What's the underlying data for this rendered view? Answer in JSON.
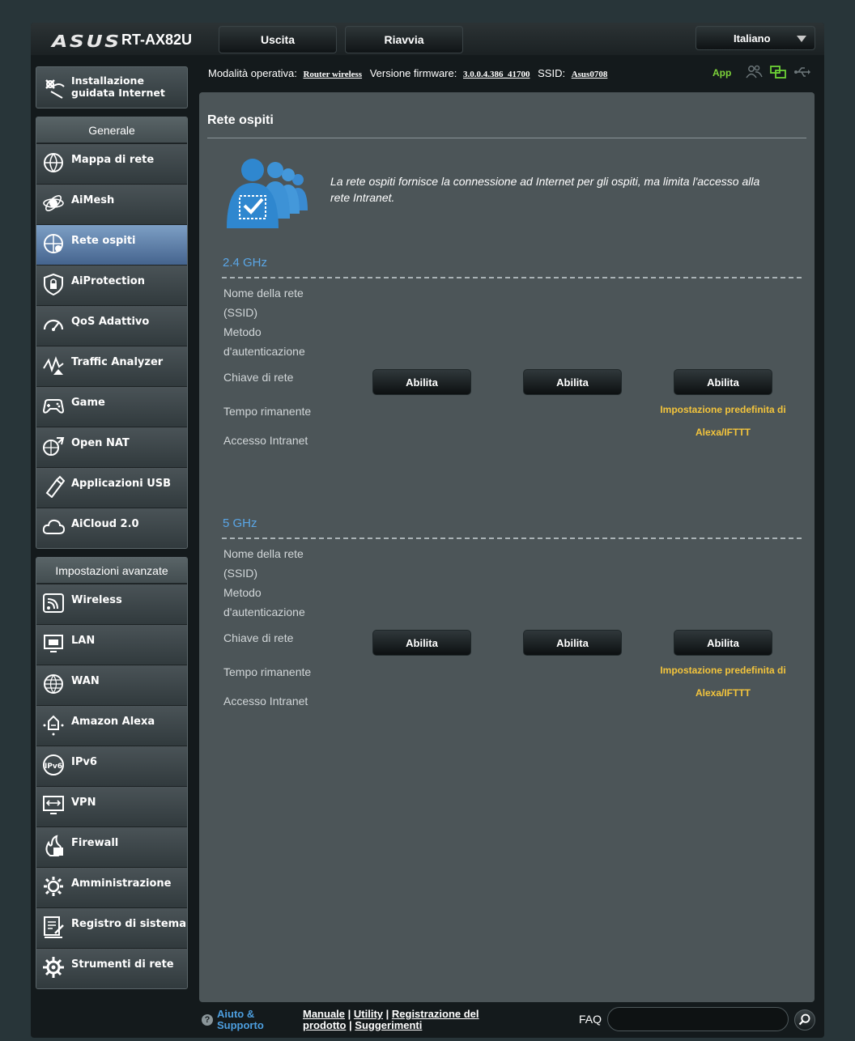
{
  "header": {
    "brand": "ASUS",
    "model": "RT-AX82U",
    "logout_label": "Uscita",
    "reboot_label": "Riavvia",
    "language": "Italiano"
  },
  "status": {
    "mode_label": "Modalità operativa:",
    "mode_value": "Router wireless",
    "firmware_label": "Versione firmware:",
    "firmware_value": "3.0.0.4.386_41700",
    "ssid_label": "SSID:",
    "ssid_value": "Asus0708",
    "app_label": "App",
    "icons": [
      "clients-icon",
      "network-map-icon",
      "usb-icon"
    ]
  },
  "sidebar": {
    "quick_setup": "Installazione guidata Internet",
    "general_title": "Generale",
    "general_items": [
      {
        "label": "Mappa di rete",
        "icon": "network-map-icon"
      },
      {
        "label": "AiMesh",
        "icon": "aimesh-icon"
      },
      {
        "label": "Rete ospiti",
        "icon": "guest-network-icon",
        "active": true
      },
      {
        "label": "AiProtection",
        "icon": "shield-icon"
      },
      {
        "label": "QoS Adattivo",
        "icon": "qos-gauge-icon"
      },
      {
        "label": "Traffic Analyzer",
        "icon": "traffic-analyzer-icon"
      },
      {
        "label": "Game",
        "icon": "gamepad-icon"
      },
      {
        "label": "Open NAT",
        "icon": "open-nat-icon"
      },
      {
        "label": "Applicazioni USB",
        "icon": "usb-app-icon"
      },
      {
        "label": "AiCloud 2.0",
        "icon": "cloud-icon"
      }
    ],
    "advanced_title": "Impostazioni avanzate",
    "advanced_items": [
      {
        "label": "Wireless",
        "icon": "wireless-icon"
      },
      {
        "label": "LAN",
        "icon": "lan-icon"
      },
      {
        "label": "WAN",
        "icon": "wan-globe-icon"
      },
      {
        "label": "Amazon Alexa",
        "icon": "alexa-icon"
      },
      {
        "label": "IPv6",
        "icon": "ipv6-icon"
      },
      {
        "label": "VPN",
        "icon": "vpn-icon"
      },
      {
        "label": "Firewall",
        "icon": "firewall-icon"
      },
      {
        "label": "Amministrazione",
        "icon": "gear-icon"
      },
      {
        "label": "Registro di sistema",
        "icon": "system-log-icon"
      },
      {
        "label": "Strumenti di rete",
        "icon": "network-tools-icon"
      }
    ]
  },
  "main": {
    "title": "Rete ospiti",
    "description": "La rete ospiti fornisce la connessione ad Internet per gli ospiti, ma limita l'accesso alla rete Intranet.",
    "row_labels": {
      "ssid": "Nome della rete (SSID)",
      "auth": "Metodo d'autenticazione",
      "key": "Chiave di rete",
      "time": "Tempo rimanente",
      "intranet": "Accesso Intranet"
    },
    "bands": [
      {
        "name": "2.4 GHz",
        "buttons": [
          "Abilita",
          "Abilita",
          "Abilita"
        ],
        "alexa_note": "Impostazione predefinita di Alexa/IFTTT"
      },
      {
        "name": "5 GHz",
        "buttons": [
          "Abilita",
          "Abilita",
          "Abilita"
        ],
        "alexa_note": "Impostazione predefinita di Alexa/IFTTT"
      }
    ]
  },
  "footer": {
    "help": "Aiuto & Supporto",
    "links": [
      "Manuale",
      "Utility",
      "Registrazione del prodotto",
      "Suggerimenti"
    ],
    "faq_label": "FAQ",
    "faq_value": ""
  }
}
